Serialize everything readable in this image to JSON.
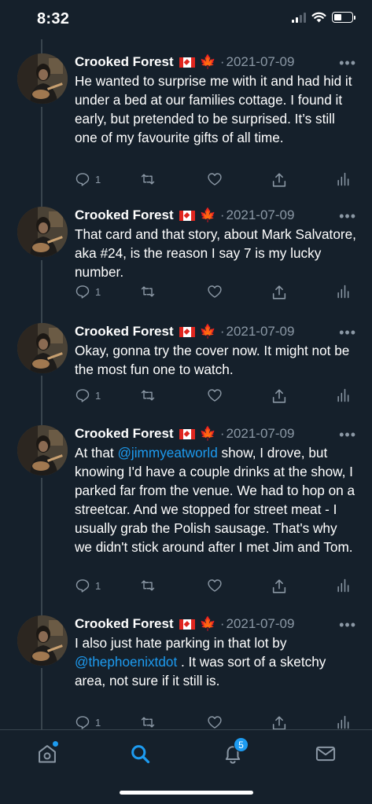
{
  "status_bar": {
    "time": "8:32"
  },
  "tweets": [
    {
      "author": "Crooked Forest",
      "flag_emoji": "canadian-flag-icon",
      "leaf_emoji": "🍁",
      "separator": "·",
      "date": "2021-07-09",
      "more": "•••",
      "text_parts": [
        "He wanted to surprise me with it and had hid it under a bed at our families cottage. I found it early, but pretended to be surprised. It’s still one of my favourite gifts of all time."
      ],
      "reply_count": "1"
    },
    {
      "author": "Crooked Forest",
      "flag_emoji": "canadian-flag-icon",
      "leaf_emoji": "🍁",
      "separator": "·",
      "date": "2021-07-09",
      "more": "•••",
      "text_parts": [
        "That card and that story, about Mark Salvatore, aka #24, is the reason I say 7 is my lucky number."
      ],
      "reply_count": "1"
    },
    {
      "author": "Crooked Forest",
      "flag_emoji": "canadian-flag-icon",
      "leaf_emoji": "🍁",
      "separator": "·",
      "date": "2021-07-09",
      "more": "•••",
      "text_parts": [
        "Okay, gonna try the cover now. It might not be the most fun one to watch."
      ],
      "reply_count": "1"
    },
    {
      "author": "Crooked Forest",
      "flag_emoji": "canadian-flag-icon",
      "leaf_emoji": "🍁",
      "separator": "·",
      "date": "2021-07-09",
      "more": "•••",
      "text_parts": [
        "At that ",
        "@jimmyeatworld",
        " show, I drove, but knowing I'd have a couple drinks at the show, I parked far from the venue. We had to hop on a streetcar. And we stopped for street meat - I usually grab the Polish sausage. That's why we didn't stick around after I met Jim and Tom."
      ],
      "reply_count": "1"
    },
    {
      "author": "Crooked Forest",
      "flag_emoji": "canadian-flag-icon",
      "leaf_emoji": "🍁",
      "separator": "·",
      "date": "2021-07-09",
      "more": "•••",
      "text_parts": [
        "I also just hate parking in that lot by ",
        "@thephoenixtdot",
        " . It was sort of a sketchy area, not sure if it still is."
      ],
      "reply_count": "1"
    }
  ],
  "tab_bar": {
    "home_icon": "home-icon",
    "search_icon": "search-icon",
    "notifications_icon": "bell-icon",
    "notifications_badge": "5",
    "messages_icon": "mail-icon",
    "active_tab": "search"
  },
  "colors": {
    "background": "#15202b",
    "accent": "#1d9bf0",
    "muted": "#8b98a5",
    "divider": "#38444d"
  }
}
